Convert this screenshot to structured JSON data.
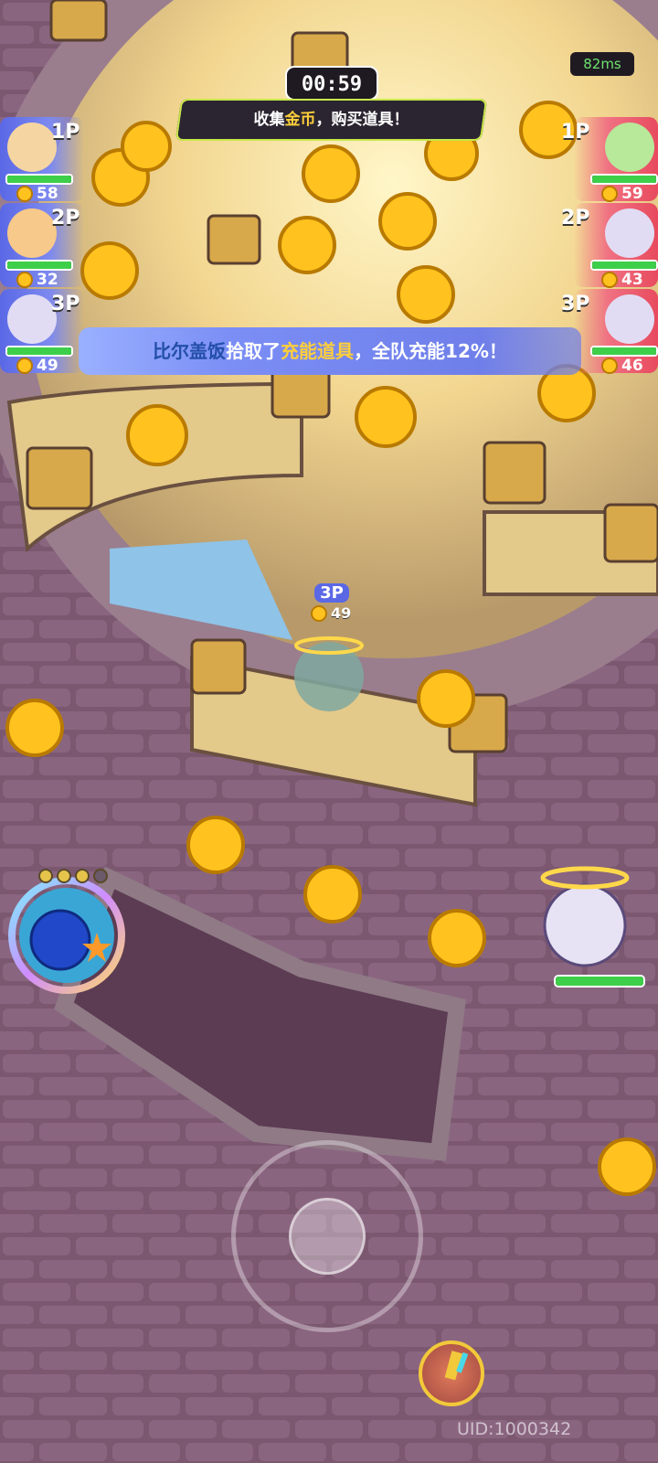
{
  "hud": {
    "timer": "00:59",
    "objective_prefix": "收集",
    "objective_highlight": "金币",
    "objective_suffix": "，购买道具！",
    "ping": "82ms",
    "uid": "UID:1000342"
  },
  "banner": {
    "player_name": "比尔盖饭",
    "verb": "拾取了",
    "item_name": "充能道具",
    "suffix": "，全队充能12%！"
  },
  "left_team": [
    {
      "id": "1P",
      "coins": "58",
      "hp": 1.0
    },
    {
      "id": "2P",
      "coins": "32",
      "hp": 1.0
    },
    {
      "id": "3P",
      "coins": "49",
      "hp": 1.0
    }
  ],
  "right_team": [
    {
      "id": "1P",
      "coins": "59",
      "hp": 1.0
    },
    {
      "id": "2P",
      "coins": "43",
      "hp": 1.0
    },
    {
      "id": "3P",
      "coins": "46",
      "hp": 1.0
    }
  ],
  "player": {
    "tag": "3P",
    "coins": "49"
  },
  "skill": {
    "charges_filled": 3,
    "charges_total": 4
  },
  "enemy_near": {
    "hp": 1.0
  },
  "colors": {
    "ally": "#5a68e6",
    "enemy": "#e84a5e",
    "coin": "#ffc21f",
    "hp": "#3ecf4a"
  },
  "icons": [
    "coin-icon",
    "skill-orb-icon",
    "joystick-icon",
    "item-torch-icon"
  ]
}
